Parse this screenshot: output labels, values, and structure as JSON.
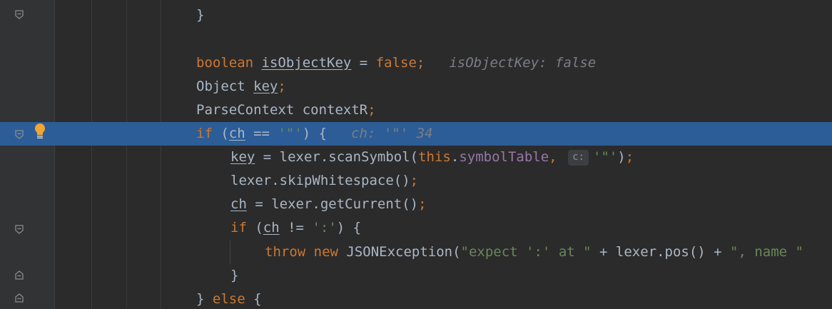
{
  "editor": {
    "lines": [
      {
        "id": "closing-brace",
        "tokens": [
          {
            "t": "}",
            "c": "pl"
          }
        ]
      },
      {
        "id": "blank",
        "tokens": []
      },
      {
        "id": "decl-isObjectKey",
        "tokens": [
          {
            "t": "boolean ",
            "c": "kw"
          },
          {
            "t": "isObjectKey",
            "c": "pl ul"
          },
          {
            "t": " = ",
            "c": "pl"
          },
          {
            "t": "false",
            "c": "kw"
          },
          {
            "t": ";",
            "c": "kw"
          }
        ],
        "hint": "isObjectKey: false"
      },
      {
        "id": "decl-key",
        "tokens": [
          {
            "t": "Object ",
            "c": "pl"
          },
          {
            "t": "key",
            "c": "pl ul"
          },
          {
            "t": ";",
            "c": "kw"
          }
        ]
      },
      {
        "id": "decl-context",
        "tokens": [
          {
            "t": "ParseContext contextR",
            "c": "pl"
          },
          {
            "t": ";",
            "c": "kw"
          }
        ]
      },
      {
        "id": "if-ch-quote",
        "current": true,
        "tokens": [
          {
            "t": "if ",
            "c": "kw"
          },
          {
            "t": "(",
            "c": "pl"
          },
          {
            "t": "ch",
            "c": "pl ul"
          },
          {
            "t": " == ",
            "c": "pl"
          },
          {
            "t": "'\"'",
            "c": "str"
          },
          {
            "t": ") {",
            "c": "pl"
          }
        ],
        "hint": "ch: '\"' 34"
      },
      {
        "id": "scan-symbol",
        "tokens": [
          {
            "t": "key",
            "c": "pl ul"
          },
          {
            "t": " = lexer.scanSymbol(",
            "c": "pl"
          },
          {
            "t": "this",
            "c": "kw"
          },
          {
            "t": ".",
            "c": "pl"
          },
          {
            "t": "symbolTable",
            "c": "fld"
          },
          {
            "t": ", ",
            "c": "kw"
          },
          {
            "t": "c:",
            "c": "param-hint"
          },
          {
            "t": "'\"'",
            "c": "str"
          },
          {
            "t": ")",
            "c": "pl"
          },
          {
            "t": ";",
            "c": "kw"
          }
        ]
      },
      {
        "id": "skip-whitespace",
        "tokens": [
          {
            "t": "lexer.skipWhitespace()",
            "c": "pl"
          },
          {
            "t": ";",
            "c": "kw"
          }
        ]
      },
      {
        "id": "get-current",
        "tokens": [
          {
            "t": "ch",
            "c": "pl ul"
          },
          {
            "t": " = lexer.getCurrent()",
            "c": "pl"
          },
          {
            "t": ";",
            "c": "kw"
          }
        ]
      },
      {
        "id": "if-ch-colon",
        "tokens": [
          {
            "t": "if ",
            "c": "kw"
          },
          {
            "t": "(",
            "c": "pl"
          },
          {
            "t": "ch",
            "c": "pl ul"
          },
          {
            "t": " != ",
            "c": "pl"
          },
          {
            "t": "':'",
            "c": "str"
          },
          {
            "t": ") {",
            "c": "pl"
          }
        ]
      },
      {
        "id": "throw",
        "tokens": [
          {
            "t": "throw new ",
            "c": "kw"
          },
          {
            "t": "JSONException(",
            "c": "pl"
          },
          {
            "t": "\"expect ':' at \"",
            "c": "str"
          },
          {
            "t": " + lexer.pos() + ",
            "c": "pl"
          },
          {
            "t": "\", name \"",
            "c": "str"
          }
        ]
      },
      {
        "id": "close-if",
        "tokens": [
          {
            "t": "}",
            "c": "pl"
          }
        ]
      },
      {
        "id": "else",
        "tokens": [
          {
            "t": "} ",
            "c": "pl"
          },
          {
            "t": "else ",
            "c": "kw"
          },
          {
            "t": "{",
            "c": "pl"
          }
        ]
      }
    ],
    "gutter_icons": [
      "fold-end-icon",
      "fold-end-icon",
      "lightbulb-icon",
      "fold-end-icon",
      "fold-end-icon",
      "fold-end-icon"
    ]
  },
  "colors": {
    "background": "#2b2b2b",
    "current_line": "#2d5d97",
    "keyword": "#cc7832",
    "string": "#6a8759",
    "field": "#9876aa",
    "plain": "#a9b7c6",
    "inline_hint": "#7a7e85",
    "bulb": "#f2a531"
  }
}
